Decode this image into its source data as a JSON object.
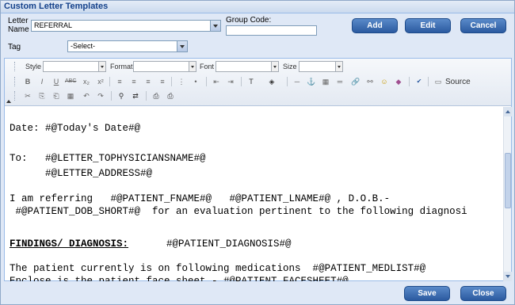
{
  "window": {
    "title": "Custom Letter Templates"
  },
  "form": {
    "letter_name_label": "Letter\nName",
    "letter_name_value": "REFERRAL",
    "group_code_label": "Group Code:",
    "group_code_value": "",
    "tag_label": "Tag",
    "tag_value": "-Select-"
  },
  "actions": {
    "add": "Add",
    "edit": "Edit",
    "cancel": "Cancel"
  },
  "toolbar": {
    "style_label": "Style",
    "format_label": "Format",
    "font_label": "Font",
    "size_label": "Size",
    "source_label": "Source",
    "row2_icons": [
      "B",
      "I",
      "U",
      "ABC",
      "x₂",
      "x²"
    ],
    "row3_icons": [
      "✂",
      "⎘",
      "⎗",
      "▦",
      "↶",
      "↷"
    ]
  },
  "content": {
    "lines": [
      "",
      "Date: #@Today's Date#@",
      "",
      "To:   #@LETTER_TOPHYSICIANSNAME#@",
      "      #@LETTER_ADDRESS#@",
      "",
      "I am referring   #@PATIENT_FNAME#@   #@PATIENT_LNAME#@ , D.O.B.-",
      " #@PATIENT_DOB_SHORT#@  for an evaluation pertinent to the following diagnosi",
      "",
      "",
      "FINDINGS/ DIAGNOSIS:   #@PATIENT_DIAGNOSIS#@",
      "",
      "The patient currently is on following medications  #@PATIENT_MEDLIST#@",
      "",
      "Enclose is the patient face sheet - #@PATIENT_FACESHEET#@"
    ]
  },
  "footer": {
    "save": "Save",
    "close": "Close"
  },
  "colors": {
    "accent": "#2b5aa0",
    "title_text": "#15428b",
    "panel_bg": "#dfe8f6"
  }
}
